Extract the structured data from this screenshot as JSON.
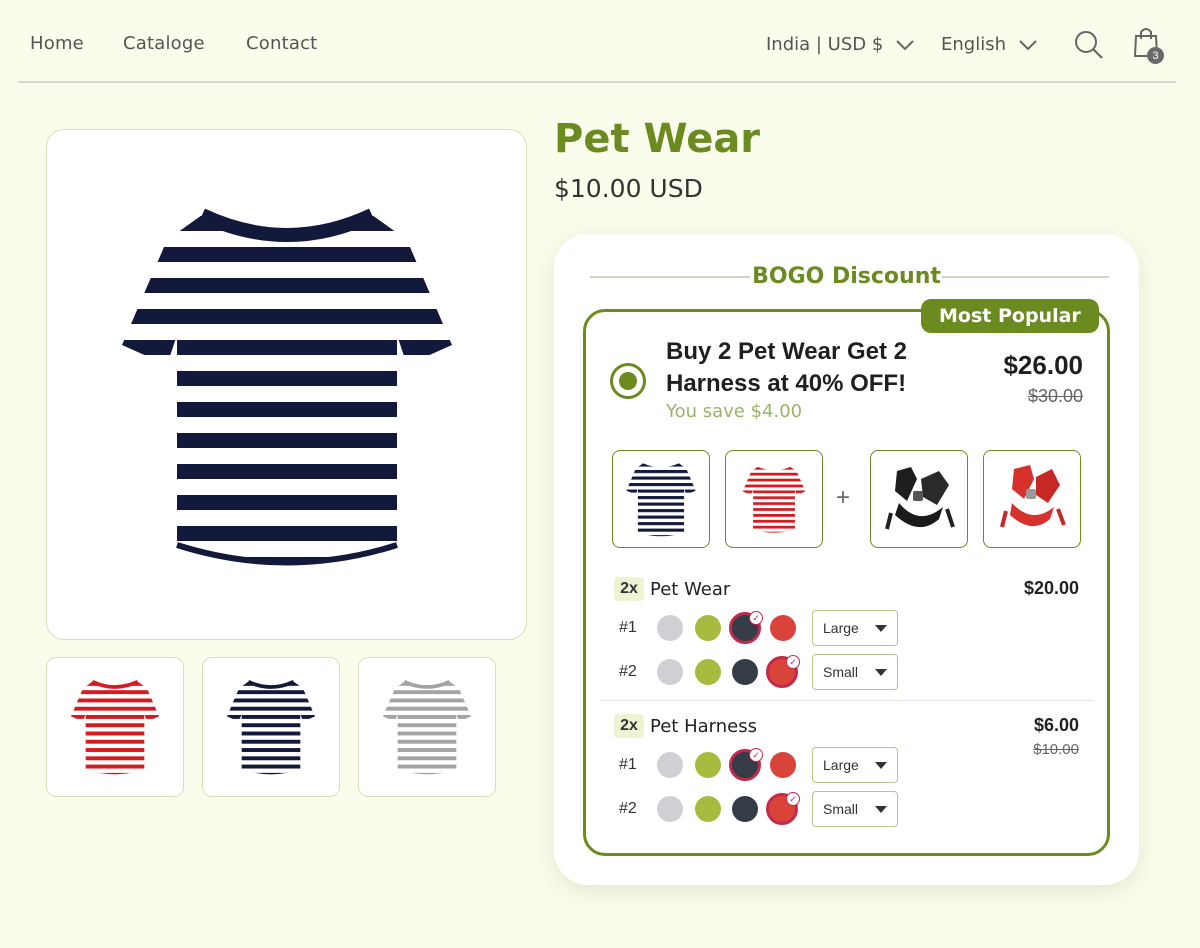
{
  "nav": {
    "links": [
      "Home",
      "Cataloge",
      "Contact"
    ],
    "region": "India | USD $",
    "language": "English",
    "cart_count": "3"
  },
  "product": {
    "title": "Pet Wear",
    "price": "$10.00 USD",
    "gallery_thumb_colors": [
      "red",
      "navy",
      "gray"
    ]
  },
  "bogo": {
    "title": "BOGO Discount",
    "badge": "Most Popular",
    "offer_line1": "Buy 2 Pet Wear Get 2",
    "offer_line2": "Harness at 40% OFF!",
    "savings": "You save $4.00",
    "price": "$26.00",
    "old_price": "$30.00",
    "plus": "+",
    "items": [
      {
        "qty": "2x",
        "name": "Pet Wear",
        "price": "$20.00",
        "old_price": "",
        "rows": [
          {
            "label": "#1",
            "selected_color": "navy",
            "size": "Large"
          },
          {
            "label": "#2",
            "selected_color": "red",
            "size": "Small"
          }
        ]
      },
      {
        "qty": "2x",
        "name": "Pet Harness",
        "price": "$6.00",
        "old_price": "$10.00",
        "rows": [
          {
            "label": "#1",
            "selected_color": "navy",
            "size": "Large"
          },
          {
            "label": "#2",
            "selected_color": "red",
            "size": "Small"
          }
        ]
      }
    ],
    "swatch_colors": {
      "gray": "#cfcfd4",
      "olive": "#a9bb3f",
      "navy": "#363b48",
      "red": "#d9433a"
    }
  },
  "colors": {
    "accent": "#6b8a1f",
    "background": "#fbfdec",
    "selection": "#c22a4b"
  }
}
